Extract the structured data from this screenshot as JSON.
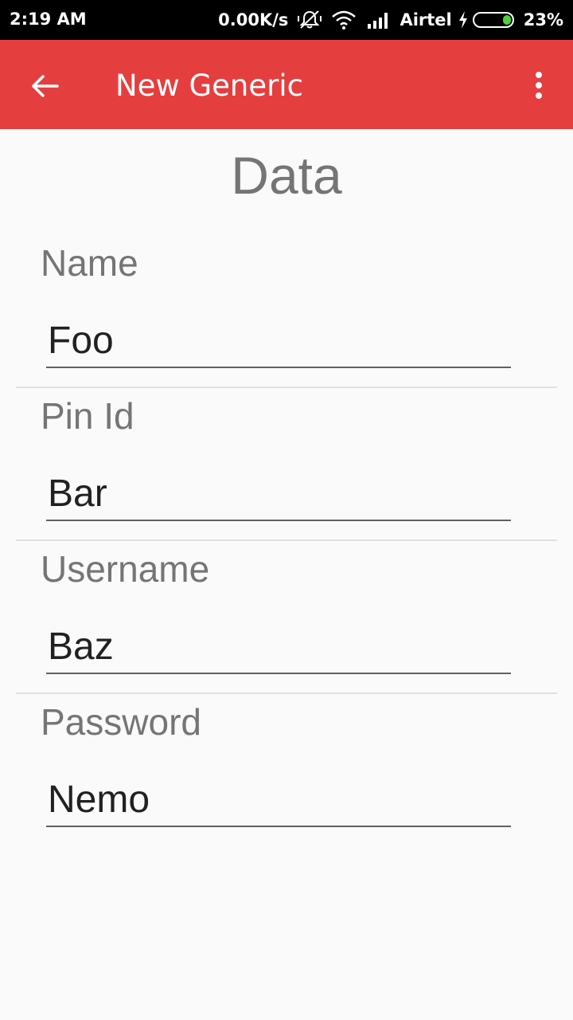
{
  "status_bar": {
    "time": "2:19 AM",
    "speed": "0.00K/s",
    "carrier": "Airtel",
    "battery_percent": "23%",
    "battery_level": 0.23,
    "icons": [
      "mute-vibrate-icon",
      "wifi-icon",
      "signal-icon",
      "charging-bolt-icon",
      "battery-icon"
    ]
  },
  "app_bar": {
    "title": "New Generic",
    "background": "#e53e3e",
    "back_icon": "arrow-left-icon",
    "overflow_icon": "more-vert-icon"
  },
  "section": {
    "title": "Data"
  },
  "fields": [
    {
      "label": "Name",
      "value": "Foo"
    },
    {
      "label": "Pin Id",
      "value": "Bar"
    },
    {
      "label": "Username",
      "value": "Baz"
    },
    {
      "label": "Password",
      "value": "Nemo"
    }
  ]
}
